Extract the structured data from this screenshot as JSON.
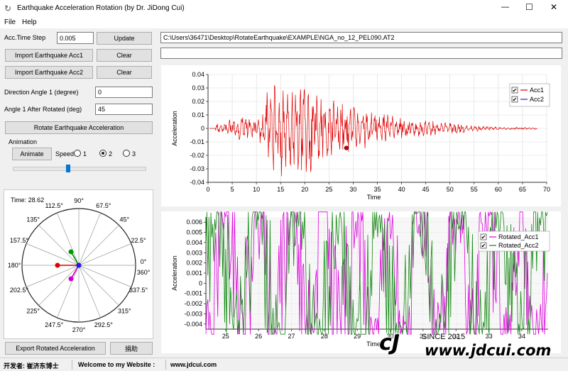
{
  "window": {
    "title": "Earthquake Acceleration Rotation (by Dr. JiDong Cui)",
    "minimize": "—",
    "maximize": "☐",
    "close": "✕"
  },
  "menu": {
    "file": "File",
    "help": "Help"
  },
  "controls": {
    "acc_time_step_label": "Acc.Time Step",
    "acc_time_step_value": "0.005",
    "update": "Update",
    "import_acc1": "Import Earthquake Acc1",
    "import_acc2": "Import Earthquake Acc2",
    "clear1": "Clear",
    "clear2": "Clear",
    "direction_angle_label": "Direction Angle 1 (degree)",
    "direction_angle_value": "0",
    "angle_after_label": "Angle 1 After Rotated (deg)",
    "angle_after_value": "45",
    "rotate_button": "Rotate Earthquake Acceleration",
    "animation_group": "Animation",
    "animate_button": "Animate",
    "speed_label": "Speed",
    "speed_options": [
      "1",
      "2",
      "3"
    ],
    "speed_selected": "2",
    "slider_value_fraction": 0.41,
    "file_path": "C:\\Users\\36471\\Desktop\\RotateEarthquake\\EXAMPLE\\NGA_no_12_PEL090.AT2",
    "file_path2": "",
    "export_button": "Export Rotated Acceleration",
    "donate_button": "捐助"
  },
  "polar": {
    "time_label": "Time: 28.62",
    "angle_labels": [
      "0°",
      "22.5°",
      "45°",
      "67.5°",
      "90°",
      "112.5°",
      "135°",
      "157.5°",
      "180°",
      "202.5°",
      "225°",
      "247.5°",
      "270°",
      "292.5°",
      "315°",
      "337.5°",
      "360°"
    ],
    "colors": {
      "red": "#e00000",
      "green": "#009900",
      "magenta": "#cc00cc",
      "blue": "#1a1aee"
    }
  },
  "chart_data": [
    {
      "type": "line",
      "xlabel": "Time",
      "ylabel": "Acceleration",
      "xlim": [
        0,
        70
      ],
      "ylim": [
        -0.04,
        0.04
      ],
      "xticks": [
        "0",
        "5",
        "10",
        "15",
        "20",
        "25",
        "30",
        "35",
        "40",
        "45",
        "50",
        "55",
        "60",
        "65",
        "70"
      ],
      "yticks": [
        "0.04",
        "0.03",
        "0.02",
        "0.01",
        "0",
        "-0.01",
        "-0.02",
        "-0.03",
        "-0.04"
      ],
      "series": [
        {
          "name": "Acc1",
          "color": "#e00000"
        },
        {
          "name": "Acc2",
          "color": "#2222dd"
        }
      ],
      "marker_point": {
        "x": 28.6,
        "y": -0.0145
      },
      "legend": "top-right"
    },
    {
      "type": "line",
      "xlabel": "Time",
      "ylabel": "Acceleration",
      "xlim": [
        24.4,
        34.8
      ],
      "ylim": [
        -0.0045,
        0.0065
      ],
      "xticks": [
        "25",
        "26",
        "27",
        "28",
        "29",
        "30",
        "31",
        "32",
        "33",
        "34"
      ],
      "yticks": [
        "0.006",
        "0.005",
        "0.004",
        "0.003",
        "0.002",
        "0.001",
        "0",
        "-0.001",
        "-0.002",
        "-0.003",
        "-0.004"
      ],
      "series": [
        {
          "name": "Rotated_Acc1",
          "color": "#dd00dd"
        },
        {
          "name": "Rotated_Acc2",
          "color": "#118811"
        }
      ],
      "legend": "top-right"
    }
  ],
  "statusbar": {
    "developer": "开发者: 崔济东博士",
    "welcome": "Welcome to my Website :",
    "website": "www.jdcui.com"
  },
  "watermark": {
    "since": "SINCE 2015",
    "url": "www.jdcui.com"
  }
}
